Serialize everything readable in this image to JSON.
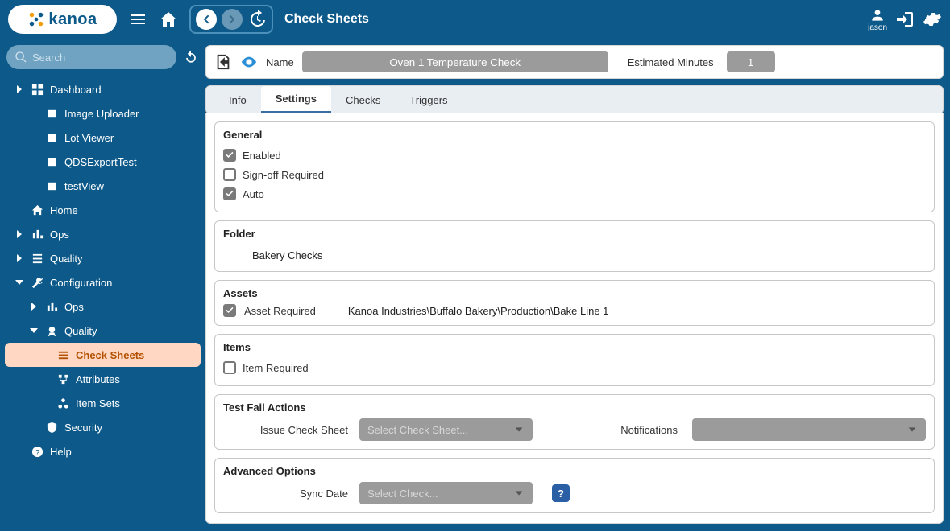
{
  "header": {
    "logo_text": "kanoa",
    "page_title": "Check Sheets",
    "user_name": "jason"
  },
  "sidebar": {
    "search_placeholder": "Search",
    "items": {
      "dashboard": "Dashboard",
      "image_uploader": "Image Uploader",
      "lot_viewer": "Lot Viewer",
      "qds_export": "QDSExportTest",
      "testview": "testView",
      "home": "Home",
      "ops": "Ops",
      "quality": "Quality",
      "configuration": "Configuration",
      "conf_ops": "Ops",
      "conf_quality": "Quality",
      "check_sheets": "Check Sheets",
      "attributes": "Attributes",
      "item_sets": "Item Sets",
      "security": "Security",
      "help": "Help"
    }
  },
  "name_bar": {
    "name_label": "Name",
    "name_value": "Oven 1 Temperature Check",
    "est_label": "Estimated Minutes",
    "est_value": "1"
  },
  "tabs": {
    "info": "Info",
    "settings": "Settings",
    "checks": "Checks",
    "triggers": "Triggers"
  },
  "settings": {
    "general": {
      "title": "General",
      "enabled": "Enabled",
      "signoff": "Sign-off Required",
      "auto": "Auto"
    },
    "folder": {
      "title": "Folder",
      "value": "Bakery Checks"
    },
    "assets": {
      "title": "Assets",
      "required": "Asset Required",
      "path": "Kanoa Industries\\Buffalo Bakery\\Production\\Bake Line 1"
    },
    "items": {
      "title": "Items",
      "required": "Item Required"
    },
    "fail": {
      "title": "Test Fail Actions",
      "issue_label": "Issue Check Sheet",
      "issue_placeholder": "Select Check Sheet...",
      "notif_label": "Notifications"
    },
    "adv": {
      "title": "Advanced Options",
      "sync_label": "Sync Date",
      "sync_placeholder": "Select Check...",
      "help": "?"
    }
  }
}
